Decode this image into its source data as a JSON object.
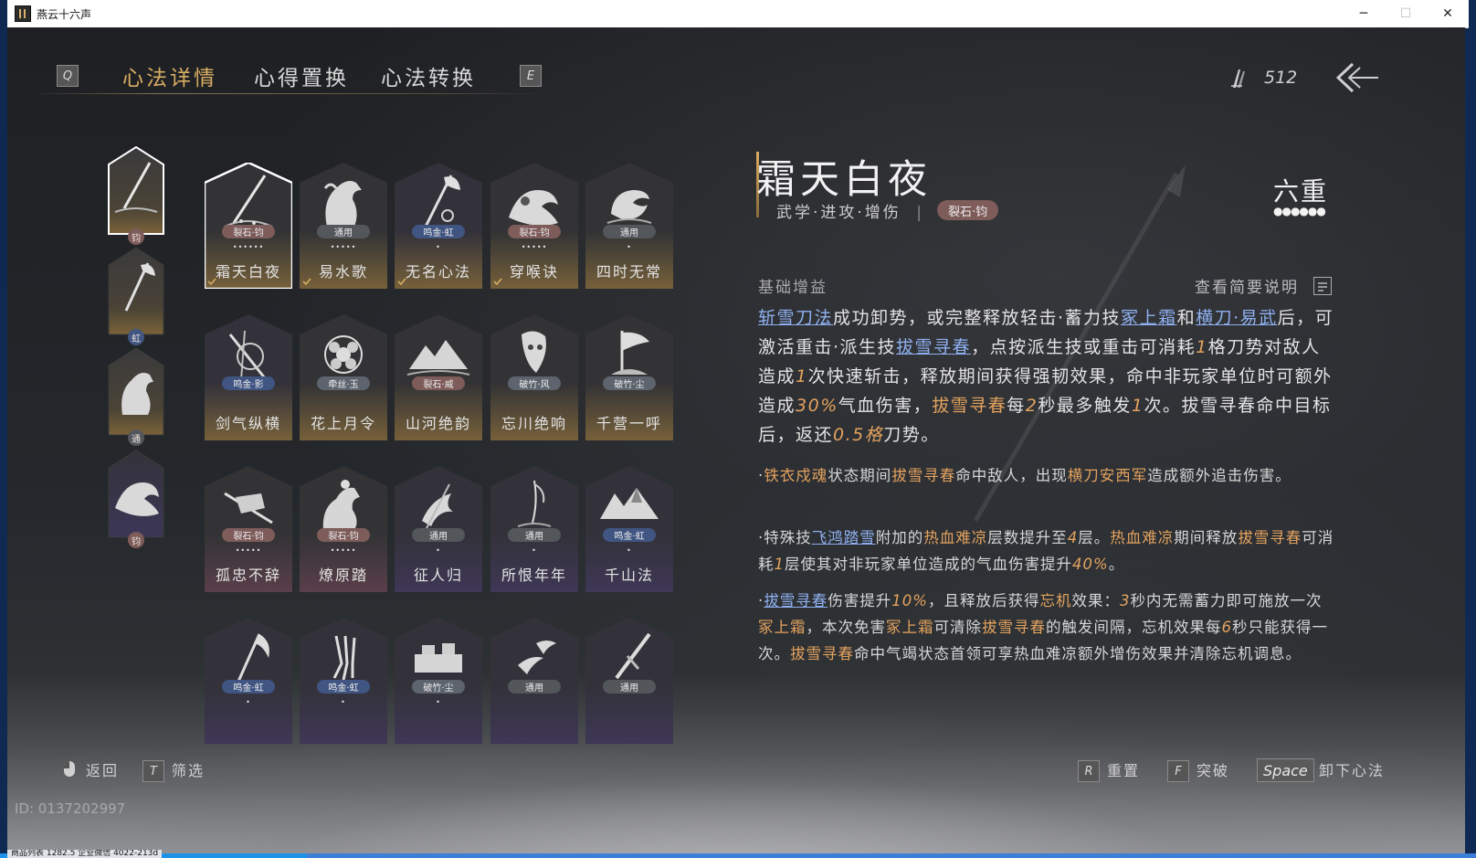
{
  "window": {
    "title": "燕云十六声",
    "minimize": "─",
    "maximize": "☐",
    "close": "✕"
  },
  "nav": {
    "key_left": "Q",
    "key_right": "E",
    "tabs": [
      {
        "label": "心法详情",
        "active": true
      },
      {
        "label": "心得置换",
        "active": false
      },
      {
        "label": "心法转换",
        "active": false
      }
    ]
  },
  "currency": {
    "icon": "feather-currency-icon",
    "value": "512"
  },
  "sidebar": {
    "slots": [
      {
        "icon": "sword-art-icon",
        "badge": "钧",
        "badge_color": "#7d5c5a"
      },
      {
        "icon": "axe-art-icon",
        "badge": "虹",
        "badge_color": "#405582"
      },
      {
        "icon": "horse-art-icon",
        "badge": "通",
        "badge_color": "#53575c"
      },
      {
        "icon": "wave-art-icon",
        "badge": "钧",
        "badge_color": "#7d5c5a"
      }
    ]
  },
  "cards": [
    {
      "name": "霜天白夜",
      "tag": "裂石·钧",
      "tag_style": "rf",
      "dots": "••••••",
      "equipped": true,
      "selected": true,
      "art": "sword-icon"
    },
    {
      "name": "易水歌",
      "tag": "通用",
      "tag_style": "ty",
      "dots": "•••••",
      "equipped": true,
      "art": "horse-icon"
    },
    {
      "name": "无名心法",
      "tag": "鸣金·虹",
      "tag_style": "mh",
      "dots": "•",
      "equipped": true,
      "art": "axe-icon"
    },
    {
      "name": "穿喉诀",
      "tag": "裂石·钧",
      "tag_style": "rf",
      "dots": "•••••",
      "equipped": true,
      "art": "wave-icon"
    },
    {
      "name": "四时无常",
      "tag": "通用",
      "tag_style": "ty",
      "dots": "•",
      "equipped": false,
      "art": "fish-icon"
    },
    {
      "name": "剑气纵横",
      "tag": "鸣金·影",
      "tag_style": "mh",
      "dots": "",
      "equipped": false,
      "art": "blades-icon"
    },
    {
      "name": "花上月令",
      "tag": "牵丝·玉",
      "tag_style": "qi",
      "dots": "",
      "equipped": false,
      "art": "flower-icon"
    },
    {
      "name": "山河绝韵",
      "tag": "裂石·威",
      "tag_style": "rf",
      "dots": "",
      "equipped": false,
      "art": "mountain-icon"
    },
    {
      "name": "忘川绝响",
      "tag": "破竹·风",
      "tag_style": "qi",
      "dots": "",
      "equipped": false,
      "art": "mask-icon"
    },
    {
      "name": "千营一呼",
      "tag": "破竹·尘",
      "tag_style": "qi",
      "dots": "",
      "equipped": false,
      "art": "flag-icon"
    },
    {
      "name": "孤忠不辞",
      "tag": "裂石·钧",
      "tag_style": "rf",
      "dots": "•••••",
      "equipped": false,
      "art": "drum-icon"
    },
    {
      "name": "燎原踏",
      "tag": "裂石·钧",
      "tag_style": "rf",
      "dots": "•••••",
      "equipped": false,
      "art": "rider-icon"
    },
    {
      "name": "征人归",
      "tag": "通用",
      "tag_style": "ty",
      "dots": "•",
      "equipped": false,
      "art": "bird-icon"
    },
    {
      "name": "所恨年年",
      "tag": "通用",
      "tag_style": "ty",
      "dots": "•",
      "equipped": false,
      "art": "willow-icon"
    },
    {
      "name": "千山法",
      "tag": "鸣金·虹",
      "tag_style": "mh",
      "dots": "•",
      "equipped": false,
      "art": "peaks-icon"
    },
    {
      "name": "",
      "tag": "鸣金·虹",
      "tag_style": "mh",
      "dots": "•",
      "equipped": false,
      "art": "scythe-icon"
    },
    {
      "name": "",
      "tag": "鸣金·虹",
      "tag_style": "mh",
      "dots": "•",
      "equipped": false,
      "art": "claw-icon"
    },
    {
      "name": "",
      "tag": "破竹·尘",
      "tag_style": "qi",
      "dots": "•",
      "equipped": false,
      "art": "city-icon"
    },
    {
      "name": "",
      "tag": "通用",
      "tag_style": "ty",
      "dots": "",
      "equipped": false,
      "art": "swallow-icon"
    },
    {
      "name": "",
      "tag": "通用",
      "tag_style": "ty",
      "dots": "",
      "equipped": false,
      "art": "dagger-icon"
    }
  ],
  "detail": {
    "title": "霜天白夜",
    "category": "武学·进攻·增伤",
    "separator": "|",
    "badge": "裂石·钧",
    "rank": "六重",
    "rank_dots": "●●●●●●",
    "section_label": "基础增益",
    "view_brief": "查看简要说明",
    "main": [
      {
        "t": "斩雪刀法",
        "s": "link"
      },
      {
        "t": "成功卸势，或完整释放轻击·蓄力技",
        "s": ""
      },
      {
        "t": "冢上霜",
        "s": "link"
      },
      {
        "t": "和",
        "s": ""
      },
      {
        "t": "横刀·易武",
        "s": "link"
      },
      {
        "t": "后，可激活重击·派生技",
        "s": ""
      },
      {
        "t": "拔雪寻春",
        "s": "link"
      },
      {
        "t": "，点按派生技或重击可消耗",
        "s": ""
      },
      {
        "t": "1",
        "s": "num"
      },
      {
        "t": "格刀势对敌人造成",
        "s": ""
      },
      {
        "t": "1",
        "s": "num"
      },
      {
        "t": "次快速斩击，释放期间获得强韧效果，命中非玩家单位时可额外造成",
        "s": ""
      },
      {
        "t": "30%",
        "s": "num"
      },
      {
        "t": "气血伤害，",
        "s": ""
      },
      {
        "t": "拔雪寻春",
        "s": "hl"
      },
      {
        "t": "每",
        "s": ""
      },
      {
        "t": "2",
        "s": "num"
      },
      {
        "t": "秒最多触发",
        "s": ""
      },
      {
        "t": "1",
        "s": "num"
      },
      {
        "t": "次。拔雪寻春命中目标后，返还",
        "s": ""
      },
      {
        "t": "0.5格",
        "s": "num"
      },
      {
        "t": "刀势。",
        "s": ""
      }
    ],
    "p1": [
      {
        "t": "·",
        "s": ""
      },
      {
        "t": "铁衣戍魂",
        "s": "hl"
      },
      {
        "t": "状态期间",
        "s": ""
      },
      {
        "t": "拔雪寻春",
        "s": "hl"
      },
      {
        "t": "命中敌人，出现",
        "s": ""
      },
      {
        "t": "横刀安西军",
        "s": "hl"
      },
      {
        "t": "造成额外追击伤害。",
        "s": ""
      }
    ],
    "p2": [
      {
        "t": "·特殊技",
        "s": ""
      },
      {
        "t": "飞鸿踏雪",
        "s": "link"
      },
      {
        "t": "附加的",
        "s": ""
      },
      {
        "t": "热血难凉",
        "s": "hl"
      },
      {
        "t": "层数提升至",
        "s": ""
      },
      {
        "t": "4",
        "s": "num"
      },
      {
        "t": "层。",
        "s": ""
      },
      {
        "t": "热血难凉",
        "s": "hl"
      },
      {
        "t": "期间释放",
        "s": ""
      },
      {
        "t": "拔雪寻春",
        "s": "hl"
      },
      {
        "t": "可消耗",
        "s": ""
      },
      {
        "t": "1",
        "s": "num"
      },
      {
        "t": "层使其对非玩家单位造成的气血伤害提升",
        "s": ""
      },
      {
        "t": "40%",
        "s": "num"
      },
      {
        "t": "。",
        "s": ""
      }
    ],
    "p3": [
      {
        "t": "·",
        "s": ""
      },
      {
        "t": "拔雪寻春",
        "s": "link"
      },
      {
        "t": "伤害提升",
        "s": ""
      },
      {
        "t": "10%",
        "s": "num"
      },
      {
        "t": "，且释放后获得",
        "s": ""
      },
      {
        "t": "忘机",
        "s": "hl"
      },
      {
        "t": "效果：",
        "s": ""
      },
      {
        "t": "3",
        "s": "num"
      },
      {
        "t": "秒内无需蓄力即可施放一次",
        "s": ""
      },
      {
        "t": "冢上霜",
        "s": "hl"
      },
      {
        "t": "，本次免害",
        "s": ""
      },
      {
        "t": "冢上霜",
        "s": "hl"
      },
      {
        "t": "可清除",
        "s": ""
      },
      {
        "t": "拔雪寻春",
        "s": "hl"
      },
      {
        "t": "的触发间隔，忘机效果每",
        "s": ""
      },
      {
        "t": "6",
        "s": "num"
      },
      {
        "t": "秒只能获得一次。",
        "s": ""
      },
      {
        "t": "拔雪寻春",
        "s": "hl"
      },
      {
        "t": "命中气竭状态首领可享热血难凉额外增伤效果并清除忘机调息。",
        "s": ""
      }
    ]
  },
  "footer": {
    "back": "返回",
    "filter_key": "T",
    "filter": "筛选",
    "reset_key": "R",
    "reset": "重置",
    "break_key": "F",
    "break": "突破",
    "unload_key": "Space",
    "unload": "卸下心法"
  },
  "player_id": "ID: 0137202997",
  "taskbar_text": "商品列表    1282.5    企业微信    4022-213d"
}
